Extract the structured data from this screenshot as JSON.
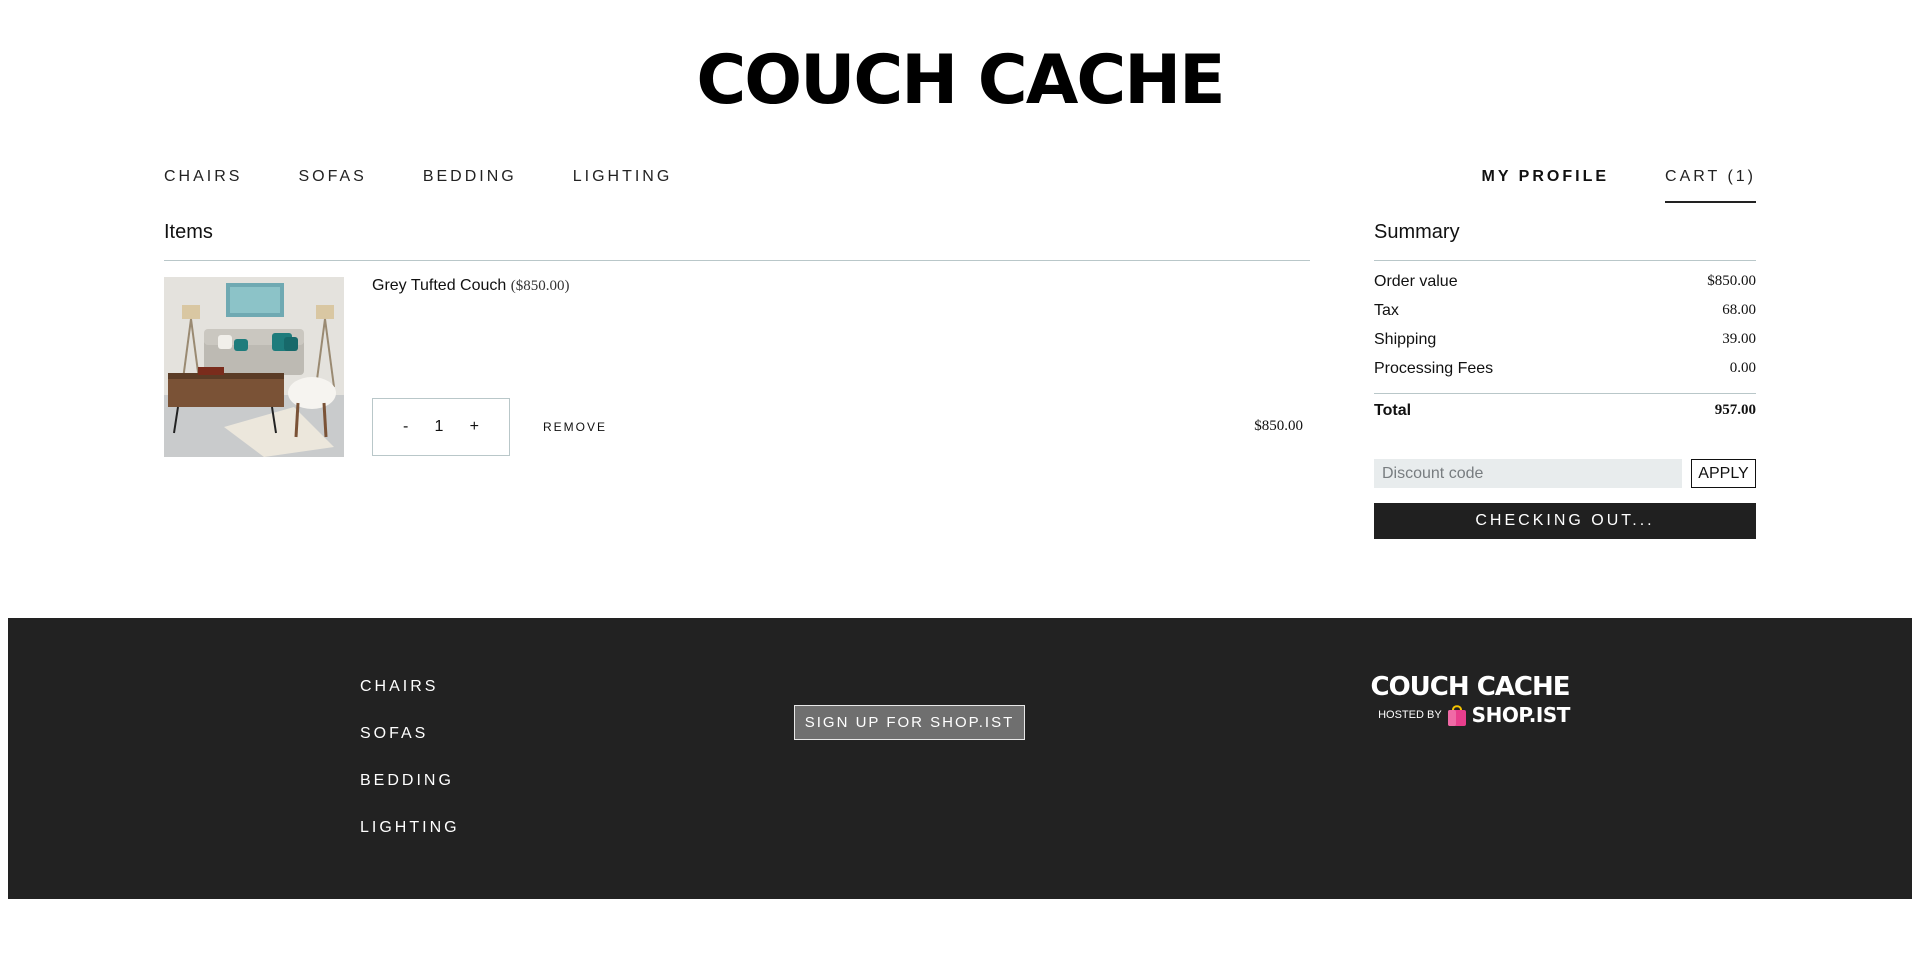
{
  "header": {
    "brand": "COUCH CACHE",
    "nav_left": [
      "CHAIRS",
      "SOFAS",
      "BEDDING",
      "LIGHTING"
    ],
    "profile": "MY PROFILE",
    "cart": "CART (1)"
  },
  "items": {
    "heading": "Items",
    "list": [
      {
        "name": "Grey Tufted Couch",
        "unit_price": "($850.00)",
        "quantity": "1",
        "decrement": "-",
        "increment": "+",
        "remove": "REMOVE",
        "line_total": "$850.00"
      }
    ]
  },
  "summary": {
    "heading": "Summary",
    "rows": [
      {
        "label": "Order value",
        "value": "$850.00"
      },
      {
        "label": "Tax",
        "value": "68.00"
      },
      {
        "label": "Shipping",
        "value": "39.00"
      },
      {
        "label": "Processing Fees",
        "value": "0.00"
      }
    ],
    "total_label": "Total",
    "total_value": "957.00",
    "discount_placeholder": "Discount code",
    "apply": "APPLY",
    "checkout": "CHECKING OUT..."
  },
  "footer": {
    "links": [
      "CHAIRS",
      "SOFAS",
      "BEDDING",
      "LIGHTING"
    ],
    "signup": "SIGN UP FOR SHOP.IST",
    "brand": "COUCH CACHE",
    "hosted_by": "HOSTED BY",
    "host_name": "SHOP.IST"
  },
  "colors": {
    "footer_bg": "#222222",
    "button_dark": "#202020",
    "divider": "#b9c7c9",
    "bag_pink": "#e83e8c",
    "bag_yellow": "#f5c400"
  }
}
